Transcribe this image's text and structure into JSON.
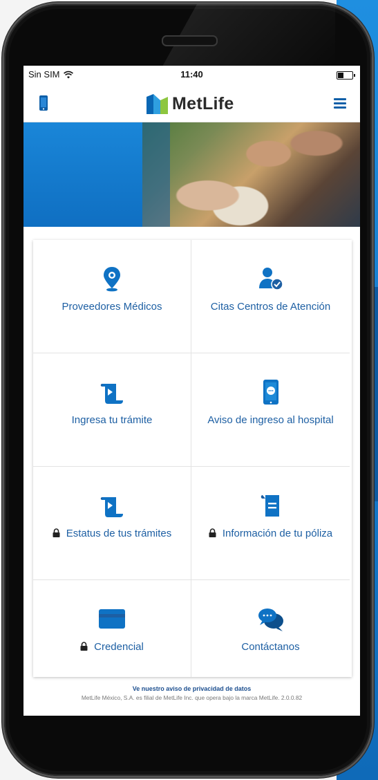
{
  "status_bar": {
    "carrier": "Sin SIM",
    "time": "11:40"
  },
  "header": {
    "brand": "MetLife"
  },
  "tiles": [
    {
      "label": "Proveedores Médicos",
      "icon": "location-pin-icon",
      "locked": false
    },
    {
      "label": "Citas Centros de Atención",
      "icon": "user-check-icon",
      "locked": false
    },
    {
      "label": "Ingresa tu trámite",
      "icon": "scroll-arrow-icon",
      "locked": false
    },
    {
      "label": "Aviso de ingreso al hospital",
      "icon": "phone-chat-icon",
      "locked": false
    },
    {
      "label": "Estatus de tus trámites",
      "icon": "scroll-arrow-icon",
      "locked": true
    },
    {
      "label": "Información de tu póliza",
      "icon": "document-icon",
      "locked": true
    },
    {
      "label": "Credencial",
      "icon": "credit-card-icon",
      "locked": true
    },
    {
      "label": "Contáctanos",
      "icon": "chat-bubbles-icon",
      "locked": false
    }
  ],
  "footer": {
    "privacy_link": "Ve nuestro aviso de privacidad de datos",
    "legal": "MetLife México, S.A. es filial de MetLife Inc. que opera bajo la marca MetLife. 2.0.0.82"
  },
  "colors": {
    "brand_blue": "#1d5fa3",
    "icon_blue": "#0f72c4",
    "accent_green": "#8dc63f"
  }
}
